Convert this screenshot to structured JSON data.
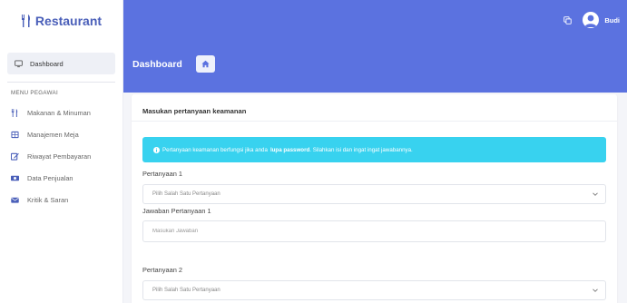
{
  "brand": {
    "name": "Restaurant"
  },
  "sidebar": {
    "dashboard_label": "Dashboard",
    "section_title": "MENU PEGAWAI",
    "items": [
      {
        "label": "Makanan & Minuman",
        "icon": "utensils-icon"
      },
      {
        "label": "Manajemen Meja",
        "icon": "table-icon"
      },
      {
        "label": "Riwayat Pembayaran",
        "icon": "edit-icon"
      },
      {
        "label": "Data Penjualan",
        "icon": "money-icon"
      },
      {
        "label": "Kritik & Saran",
        "icon": "envelope-icon"
      }
    ]
  },
  "topbar": {
    "user_name": "Budi"
  },
  "header": {
    "title": "Dashboard"
  },
  "card": {
    "title": "Masukan pertanyaan keamanan",
    "alert": {
      "text_before": "Pertanyaan keamanan berfungsi jika anda",
      "bold": "lupa password",
      "text_after": ". Silahkan isi dan ingat ingat jawabannya."
    },
    "q1_label": "Pertanyaan 1",
    "q1_select": "Pilih Salah Satu Pertanyaan",
    "a1_label": "Jawaban Pertanyaan 1",
    "a1_placeholder": "Masukan Jawaban",
    "q2_label": "Pertanyaan 2",
    "q2_select": "Pilih Salah Satu Pertanyaan"
  },
  "colors": {
    "primary": "#5b72e0",
    "brand_text": "#4a5fb9",
    "alert": "#38d2ef"
  }
}
